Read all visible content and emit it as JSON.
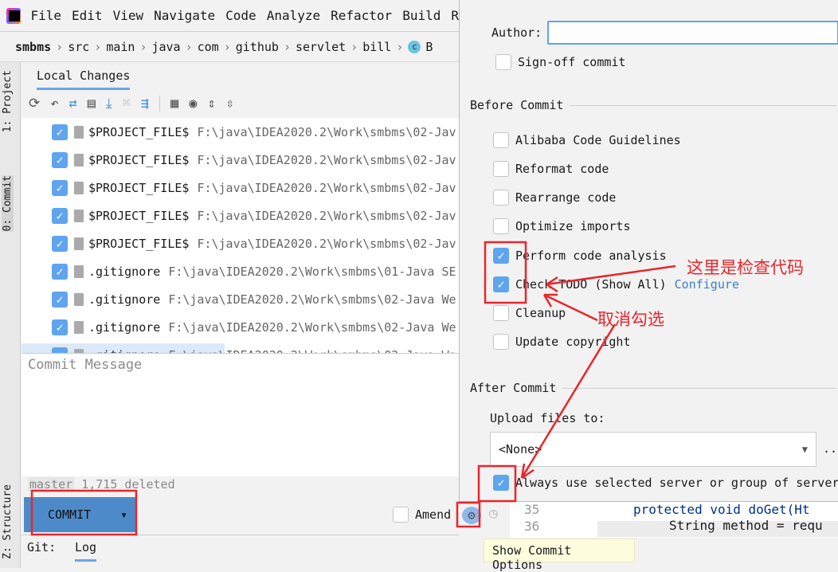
{
  "menu": [
    "File",
    "Edit",
    "View",
    "Navigate",
    "Code",
    "Analyze",
    "Refactor",
    "Build",
    "R"
  ],
  "breadcrumb": [
    "smbms",
    "src",
    "main",
    "java",
    "com",
    "github",
    "servlet",
    "bill",
    "B"
  ],
  "side_tabs": {
    "project": "1: Project",
    "commit": "0: Commit",
    "structure": "Z: Structure"
  },
  "panel": {
    "tab": "Local Changes"
  },
  "files": [
    {
      "name": "$PROJECT_FILE$",
      "path": "F:\\java\\IDEA2020.2\\Work\\smbms\\02-Jav",
      "checked": true
    },
    {
      "name": "$PROJECT_FILE$",
      "path": "F:\\java\\IDEA2020.2\\Work\\smbms\\02-Jav",
      "checked": true
    },
    {
      "name": "$PROJECT_FILE$",
      "path": "F:\\java\\IDEA2020.2\\Work\\smbms\\02-Jav",
      "checked": true
    },
    {
      "name": "$PROJECT_FILE$",
      "path": "F:\\java\\IDEA2020.2\\Work\\smbms\\02-Jav",
      "checked": true
    },
    {
      "name": "$PROJECT_FILE$",
      "path": "F:\\java\\IDEA2020.2\\Work\\smbms\\02-Jav",
      "checked": true
    },
    {
      "name": ".gitignore",
      "path": "F:\\java\\IDEA2020.2\\Work\\smbms\\01-Java SE",
      "checked": true
    },
    {
      "name": ".gitignore",
      "path": "F:\\java\\IDEA2020.2\\Work\\smbms\\02-Java We",
      "checked": true
    },
    {
      "name": ".gitignore",
      "path": "F:\\java\\IDEA2020.2\\Work\\smbms\\02-Java We",
      "checked": true
    },
    {
      "name": ".gitignore",
      "path": "F:\\java\\IDEA2020.2\\Work\\smbms\\02-Java We",
      "checked": true
    }
  ],
  "commit_message_placeholder": "Commit Message",
  "status": {
    "branch": "master",
    "summary": "1,715 deleted"
  },
  "commit_button": "COMMIT",
  "amend": "Amend",
  "git_bar": {
    "label": "Git:",
    "tab": "Log"
  },
  "editor": {
    "line_numbers": [
      "35",
      "36"
    ],
    "lines": [
      "protected void doGet(Ht",
      "String method = requ"
    ]
  },
  "tooltip": "Show Commit Options",
  "options": {
    "author_label": "Author:",
    "author_value": "",
    "sign_off": {
      "label": "Sign-off commit",
      "checked": false
    },
    "before_commit_title": "Before Commit",
    "before_commit": [
      {
        "label": "Alibaba Code Guidelines",
        "checked": false
      },
      {
        "label": "Reformat code",
        "checked": false
      },
      {
        "label": "Rearrange code",
        "checked": false
      },
      {
        "label": "Optimize imports",
        "checked": false
      },
      {
        "label": "Perform code analysis",
        "checked": true
      },
      {
        "label": "Check TODO (Show All)",
        "checked": true,
        "link": "Configure"
      },
      {
        "label": "Cleanup",
        "checked": false
      },
      {
        "label": "Update copyright",
        "checked": false
      }
    ],
    "after_commit_title": "After Commit",
    "upload_label": "Upload files to:",
    "upload_value": "<None>",
    "always_use": {
      "label": "Always use selected server or group of server",
      "checked": true
    }
  },
  "annotations": {
    "check_code": "这里是检查代码",
    "uncheck": "取消勾选",
    "color": "#e8262c"
  },
  "colors": {
    "accent": "#5ea4ef",
    "commit_button": "#4d8ac9",
    "link": "#3d7fc4"
  }
}
